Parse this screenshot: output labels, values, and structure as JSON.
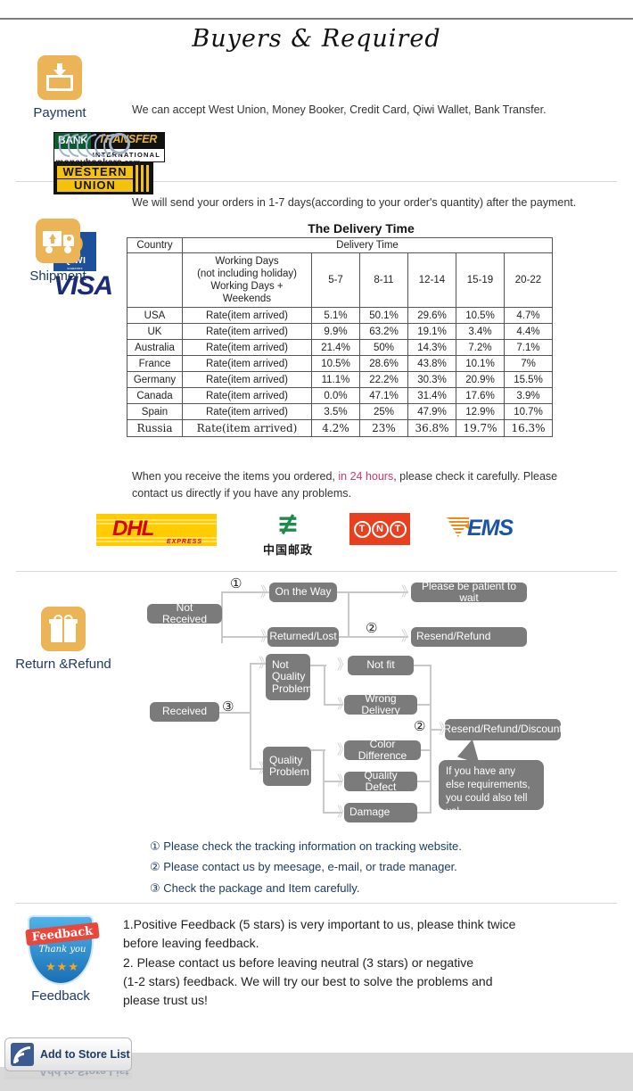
{
  "header": {
    "title": "Buyers & Required"
  },
  "colors": {
    "accent": "#eab457",
    "label": "#1c3b66",
    "highlight": "#d6336c",
    "node": "#7b7b7b"
  },
  "payment": {
    "icon": "download-tray-icon",
    "label": "Payment",
    "description": "We can accept West Union, Money Booker, Credit Card, Qiwi Wallet, Bank Transfer.",
    "logos": [
      {
        "name": "bank-transfer-logo",
        "line1": "BANK",
        "line2": "TRANSFER",
        "line3": "INTERNATIONAL"
      },
      {
        "name": "western-union-logo",
        "line1": "WESTERN",
        "line2": "UNION"
      },
      {
        "name": "moneybookers-logo",
        "line1": "moneybookers",
        "line2": ".com"
      },
      {
        "name": "qiwi-logo",
        "line1": "Q",
        "line2": "QIWI",
        "line3": "кошелек"
      },
      {
        "name": "visa-logo",
        "line1": "VISA"
      }
    ]
  },
  "shipment": {
    "icon": "truck-icon",
    "label": "Shipment",
    "description": "We will send your orders in 1-7 days(according to your order's quantity) after the payment.",
    "table_title": "The Delivery Time",
    "table": {
      "header_country": "Country",
      "header_delivery": "Delivery Time",
      "working_days_lines": [
        "Working Days",
        "(not including holiday)",
        "Working Days + Weekends"
      ],
      "day_ranges": [
        "5-7",
        "8-11",
        "12-14",
        "15-19",
        "20-22"
      ],
      "rate_label": "Rate(item arrived)",
      "rows": [
        {
          "country": "USA",
          "rate": "Rate(item arrived)",
          "values": [
            "5.1%",
            "50.1%",
            "29.6%",
            "10.5%",
            "4.7%"
          ]
        },
        {
          "country": "UK",
          "rate": "Rate(item arrived)",
          "values": [
            "9.9%",
            "63.2%",
            "19.1%",
            "3.4%",
            "4.4%"
          ]
        },
        {
          "country": "Australia",
          "rate": "Rate(item arrived)",
          "values": [
            "21.4%",
            "50%",
            "14.3%",
            "7.2%",
            "7.1%"
          ]
        },
        {
          "country": "France",
          "rate": "Rate(item arrived)",
          "values": [
            "10.5%",
            "28.6%",
            "43.8%",
            "10.1%",
            "7%"
          ]
        },
        {
          "country": "Germany",
          "rate": "Rate(item arrived)",
          "values": [
            "11.1%",
            "22.2%",
            "30.3%",
            "20.9%",
            "15.5%"
          ]
        },
        {
          "country": "Canada",
          "rate": "Rate(item arrived)",
          "values": [
            "0.0%",
            "47.1%",
            "31.4%",
            "17.6%",
            "3.9%"
          ]
        },
        {
          "country": "Spain",
          "rate": "Rate(item arrived)",
          "values": [
            "3.5%",
            "25%",
            "47.9%",
            "12.9%",
            "10.7%"
          ]
        },
        {
          "country": "Russia",
          "rate": "Rate(item arrived)",
          "values": [
            "4.2%",
            "23%",
            "36.8%",
            "19.7%",
            "16.3%"
          ]
        }
      ]
    },
    "check_text_1": "When you receive the items you ordered, ",
    "check_highlight": "in 24 hours",
    "check_text_2": ", please check it carefully. Please contact us directly if you have any problems.",
    "couriers": [
      {
        "name": "dhl-logo",
        "word": "DHL",
        "sub": "EXPRESS"
      },
      {
        "name": "china-post-logo",
        "word": "中国邮政"
      },
      {
        "name": "tnt-logo",
        "letters": [
          "T",
          "N",
          "T"
        ]
      },
      {
        "name": "ems-logo",
        "word": "EMS"
      }
    ]
  },
  "returns": {
    "icon": "gift-icon",
    "label": "Return &Refund",
    "flow": {
      "not_received": "Not Received",
      "on_the_way": "On the Way",
      "returned_lost": "Returned/Lost",
      "be_patient": "Please be patient to wait",
      "resend_refund": "Resend/Refund",
      "received": "Received",
      "not_quality_problem": "Not\nQuality\nProblem",
      "not_quality_l1": "Not",
      "not_quality_l2": "Quality",
      "not_quality_l3": "Problem",
      "not_fit": "Not fit",
      "wrong_delivery": "Wrong Delivery",
      "quality_l1": "Quality",
      "quality_l2": "Problem",
      "color_difference": "Color Difference",
      "quality_defect": "Quality Defect",
      "damage": "Damage",
      "resend_refund_discount": "Resend/Refund/Discount",
      "callout": "If you have any else requirements, you could also tell us!",
      "marker1": "①",
      "marker2": "②",
      "marker2b": "②",
      "marker3": "③"
    },
    "notes": [
      {
        "num": "①",
        "text": "Please check the tracking information on tracking website."
      },
      {
        "num": "②",
        "text": "Please contact us by meesage, e-mail, or trade manager."
      },
      {
        "num": "③",
        "text": "Check the package and Item carefully."
      }
    ]
  },
  "feedback": {
    "icon": "feedback-shield-icon",
    "label": "Feedback",
    "badge_title": "Feedback",
    "badge_sub": "Thank you",
    "badge_stars": "★★★",
    "lines": [
      "1.Positive Feedback (5 stars) is very important to us, please think twice",
      " before leaving feedback.",
      "2. Please contact us before leaving neutral (3 stars) or negative",
      "(1-2 stars) feedback. We will try our best to solve the problems and",
      " please trust us!"
    ]
  },
  "footer": {
    "store_button_label": "Add to Store List",
    "store_button_icon": "rss-icon"
  }
}
